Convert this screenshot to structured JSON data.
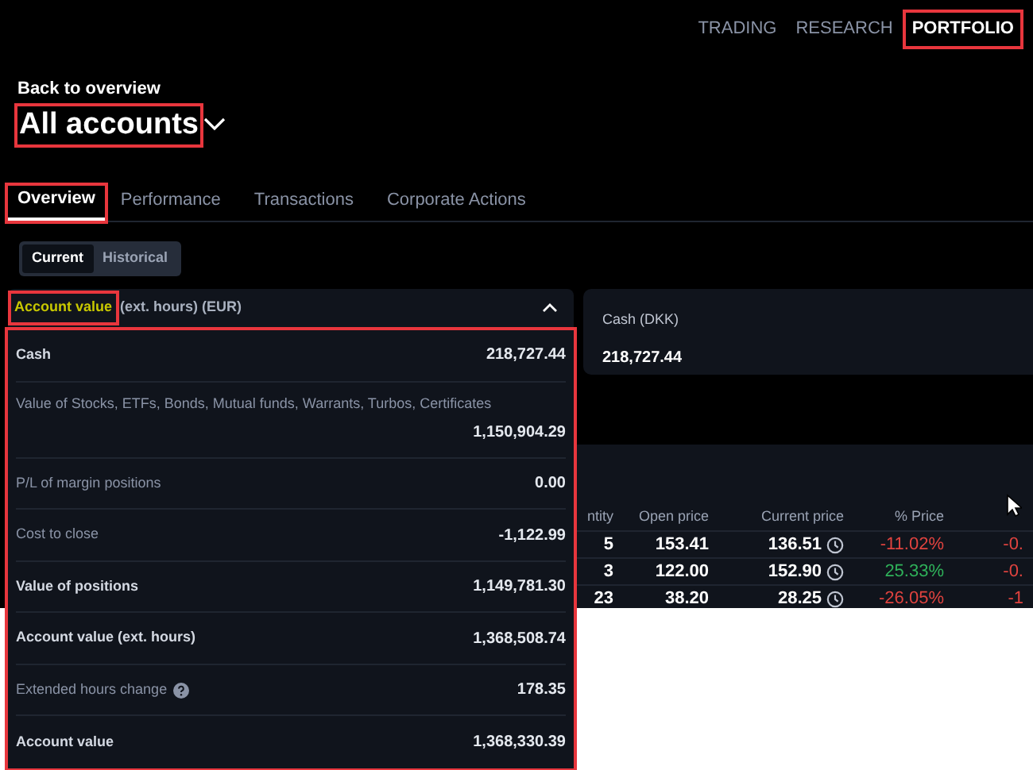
{
  "nav": [
    {
      "label": "TRADING",
      "selected": false,
      "highlighted": false
    },
    {
      "label": "RESEARCH",
      "selected": false,
      "highlighted": false
    },
    {
      "label": "PORTFOLIO",
      "selected": true,
      "highlighted": true
    }
  ],
  "back_link": "Back to overview",
  "title": {
    "text": "All accounts",
    "highlighted": true
  },
  "tabs": [
    {
      "label": "Overview",
      "selected": true,
      "highlighted": true
    },
    {
      "label": "Performance",
      "selected": false,
      "highlighted": false
    },
    {
      "label": "Transactions",
      "selected": false,
      "highlighted": false
    },
    {
      "label": "Corporate Actions",
      "selected": false,
      "highlighted": false
    }
  ],
  "toggle": [
    {
      "label": "Current",
      "selected": true
    },
    {
      "label": "Historical",
      "selected": false
    }
  ],
  "account_panel": {
    "header_highlighted": "Account value",
    "header_rest": "(ext. hours) (EUR)",
    "expanded": true,
    "highlighted": true,
    "rows": [
      {
        "label": "Cash",
        "value": "218,727.44",
        "strong": true,
        "info": false
      },
      {
        "label": "Value of Stocks, ETFs, Bonds, Mutual funds, Warrants, Turbos, Certificates",
        "value": "1,150,904.29",
        "strong": false,
        "info": false
      },
      {
        "label": "P/L of margin positions",
        "value": "0.00",
        "strong": false,
        "info": false
      },
      {
        "label": "Cost to close",
        "value": "-1,122.99",
        "strong": false,
        "info": false
      },
      {
        "label": "Value of positions",
        "value": "1,149,781.30",
        "strong": true,
        "info": false
      },
      {
        "label": "Account value (ext. hours)",
        "value": "1,368,508.74",
        "strong": true,
        "info": false
      },
      {
        "label": "Extended hours change",
        "value": "178.35",
        "strong": false,
        "info": true
      },
      {
        "label": "Account value",
        "value": "1,368,330.39",
        "strong": true,
        "info": false
      }
    ]
  },
  "cash_card": {
    "label": "Cash (DKK)",
    "value": "218,727.44"
  },
  "positions_table": {
    "columns": [
      "ntity",
      "Open price",
      "Current price",
      "% Price"
    ],
    "rows": [
      {
        "cells": [
          "5",
          "153.41",
          "136.51",
          "-11.02%",
          "-0."
        ],
        "color": "#e0433f"
      },
      {
        "cells": [
          "3",
          "122.00",
          "152.90",
          "25.33%",
          "-0."
        ],
        "color": "#2fb25a"
      },
      {
        "cells": [
          "23",
          "38.20",
          "28.25",
          "-26.05%",
          "-1"
        ],
        "color": "#e0433f"
      }
    ]
  }
}
